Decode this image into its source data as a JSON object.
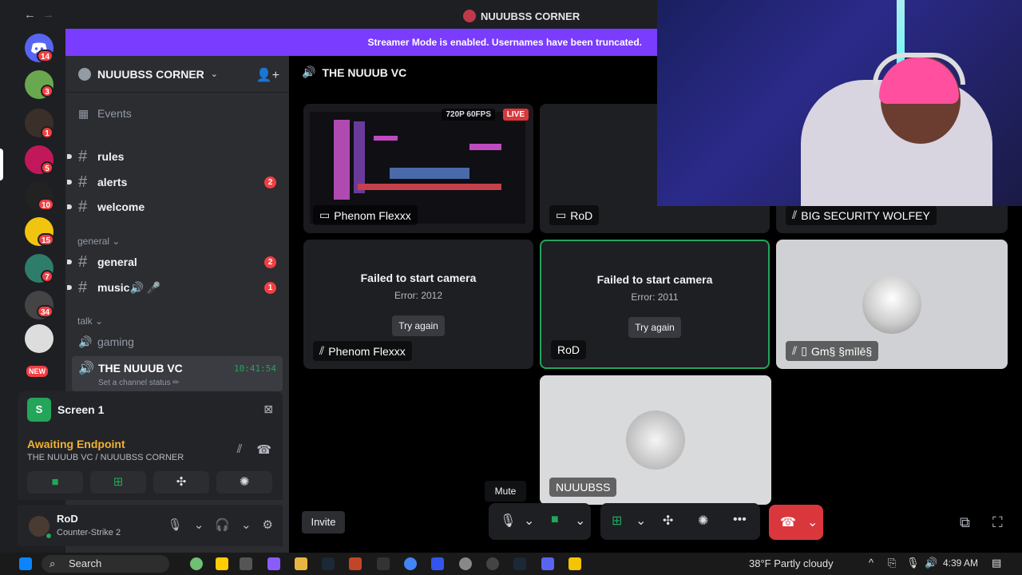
{
  "titlebar": {
    "back": "←",
    "forward": "→",
    "title": "NUUUBSS CORNER"
  },
  "rail": {
    "servers": [
      {
        "name": "discord-home",
        "badge": "14",
        "color": "#5865f2"
      },
      {
        "name": "server-turtle",
        "badge": "3",
        "color": "#6aa84f"
      },
      {
        "name": "server-dark",
        "badge": "1",
        "color": "#3b2f2a"
      },
      {
        "name": "server-pink",
        "badge": "5",
        "color": "#c2185b"
      },
      {
        "name": "server-prime",
        "badge": "10",
        "color": "#222222"
      },
      {
        "name": "server-emoji",
        "badge": "15",
        "color": "#f1c40f"
      },
      {
        "name": "server-green",
        "badge": "7",
        "color": "#2e7d6b"
      },
      {
        "name": "server-plane",
        "badge": "34",
        "color": "#444444"
      },
      {
        "name": "server-skull",
        "badge": "",
        "color": "#dddddd"
      },
      {
        "name": "server-new",
        "badge": "NEW",
        "color": "#c62828"
      }
    ]
  },
  "banner": {
    "text": "Streamer Mode is enabled. Usernames have been truncated."
  },
  "sidebar": {
    "guild_name": "NUUUBSS CORNER",
    "events_label": "Events",
    "channels_top": [
      {
        "name": "rules",
        "badge": ""
      },
      {
        "name": "alerts",
        "badge": "2"
      },
      {
        "name": "welcome",
        "badge": ""
      }
    ],
    "cat_general": "general",
    "channels_general": [
      {
        "name": "general",
        "badge": "2"
      },
      {
        "name": "music🔊 🎤",
        "badge": "1"
      }
    ],
    "cat_talk": "talk",
    "voice_gaming": "gaming",
    "active_vc": {
      "name": "THE NUUUB VC",
      "time": "10:41:54",
      "status": "Set a channel status ✏"
    }
  },
  "voice_panel": {
    "screen_icon_letter": "S",
    "screen_label": "Screen 1",
    "state": "Awaiting Endpoint",
    "location": "THE NUUUB VC / NUUUBSS CORNER"
  },
  "user": {
    "name": "RoD",
    "status": "Counter-Strike 2"
  },
  "call": {
    "header": "THE NUUUB VC",
    "stream_quality": "720P 60FPS",
    "live_label": "LIVE",
    "tiles": [
      {
        "name": "Phenom Flexxx"
      },
      {
        "name": "RoD"
      },
      {
        "name": "BIG SECURITY WOLFEY"
      },
      {
        "name": "Phenom Flexxx",
        "fail_title": "Failed to start camera",
        "error": "Error: 2012",
        "btn": "Try again"
      },
      {
        "name": "RoD",
        "fail_title": "Failed to start camera",
        "error": "Error: 2011",
        "btn": "Try again"
      },
      {
        "name": "Gm§ §mīlē§"
      },
      {
        "name": "NUUUBSS"
      }
    ],
    "invite_label": "Invite",
    "tooltip": "Mute"
  },
  "taskbar": {
    "search_label": "Search",
    "weather": "38°F  Partly cloudy",
    "time": "4:39 AM"
  },
  "colors": {
    "accent": "#5865f2",
    "green": "#23a55a",
    "red": "#da373c",
    "banner": "#7a3cff"
  }
}
